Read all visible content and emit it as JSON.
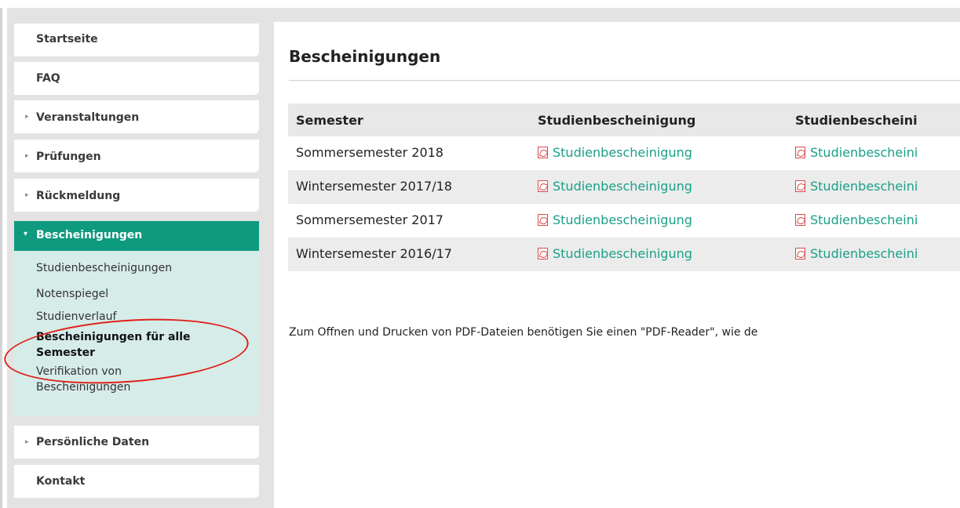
{
  "sidebar": {
    "items": [
      {
        "label": "Startseite",
        "arrow": ""
      },
      {
        "label": "FAQ",
        "arrow": ""
      },
      {
        "label": "Veranstaltungen",
        "arrow": "▸"
      },
      {
        "label": "Prüfungen",
        "arrow": "▸"
      },
      {
        "label": "Rückmeldung",
        "arrow": "▸"
      }
    ],
    "active": {
      "label": "Bescheinigungen",
      "arrow": "▾"
    },
    "submenu": [
      "Studienbescheinigungen",
      "Notenspiegel",
      "Studienverlauf",
      "Bescheinigungen für alle Semester",
      "Verifikation von Bescheinigungen"
    ],
    "bottom_items": [
      {
        "label": "Persönliche Daten",
        "arrow": "▸"
      },
      {
        "label": "Kontakt",
        "arrow": ""
      }
    ]
  },
  "main": {
    "title": "Bescheinigungen",
    "table": {
      "headers": [
        "Semester",
        "Studienbescheinigung",
        "Studienbescheini"
      ],
      "rows": [
        {
          "semester": "Sommersemester 2018",
          "link1": "Studienbescheinigung",
          "link2": "Studienbescheini"
        },
        {
          "semester": "Wintersemester 2017/18",
          "link1": "Studienbescheinigung",
          "link2": "Studienbescheini"
        },
        {
          "semester": "Sommersemester 2017",
          "link1": "Studienbescheinigung",
          "link2": "Studienbescheini"
        },
        {
          "semester": "Wintersemester 2016/17",
          "link1": "Studienbescheinigung",
          "link2": "Studienbescheini"
        }
      ]
    },
    "note": "Zum Öffnen und Drucken von PDF-Dateien benötigen Sie einen \"PDF-Reader\", wie de"
  },
  "colors": {
    "accent": "#0e9a7e",
    "link": "#1aa088",
    "highlight_circle": "#e0201b"
  },
  "icons": {
    "pdf": "pdf-file-icon"
  }
}
